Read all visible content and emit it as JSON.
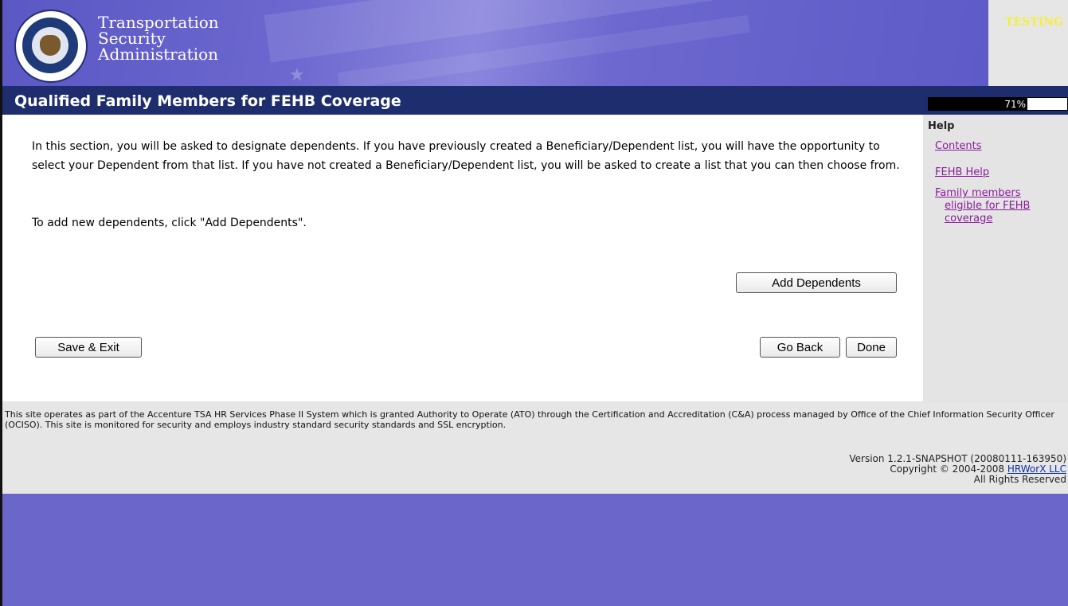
{
  "header": {
    "agency_lines": [
      "Transportation",
      "Security",
      "Administration"
    ],
    "testing_label": "TESTING"
  },
  "page": {
    "title": "Qualified Family Members for FEHB Coverage",
    "progress": {
      "value": 71,
      "label": "71%"
    }
  },
  "main": {
    "intro_text": "In this section, you will be asked to designate dependents. If you have previously created a Beneficiary/Dependent list, you will have the opportunity to select your Dependent from that list. If you have not created a Beneficiary/Dependent list, you will be asked to create a list that you can then choose from.",
    "add_note": "To add new dependents, click \"Add Dependents\".",
    "buttons": {
      "add_dependents": "Add Dependents",
      "save_exit": "Save & Exit",
      "go_back": "Go Back",
      "done": "Done"
    }
  },
  "help": {
    "title": "Help",
    "links": {
      "contents": "Contents",
      "fehb_help": "FEHB Help",
      "family_1": "Family members",
      "family_2": "eligible for FEHB",
      "family_3": "coverage"
    }
  },
  "footer": {
    "disclaimer": "This site operates as part of the Accenture TSA HR Services Phase II System which is granted Authority to Operate (ATO) through the Certification and Accreditation (C&A) process managed by Office of the Chief Information Security Officer (OCISO). This site is monitored for security and employs industry standard security standards and SSL encryption.",
    "version": "Version 1.2.1-SNAPSHOT (20080111-163950)",
    "copyright_prefix": "Copyright © 2004-2008 ",
    "copyright_link": "HRWorX LLC",
    "rights": "All Rights Reserved"
  },
  "colors": {
    "banner": "#6b66c9",
    "title_bar": "#1e2d6e",
    "help_link": "#8a1c9a",
    "testing": "#f5ee3a"
  }
}
